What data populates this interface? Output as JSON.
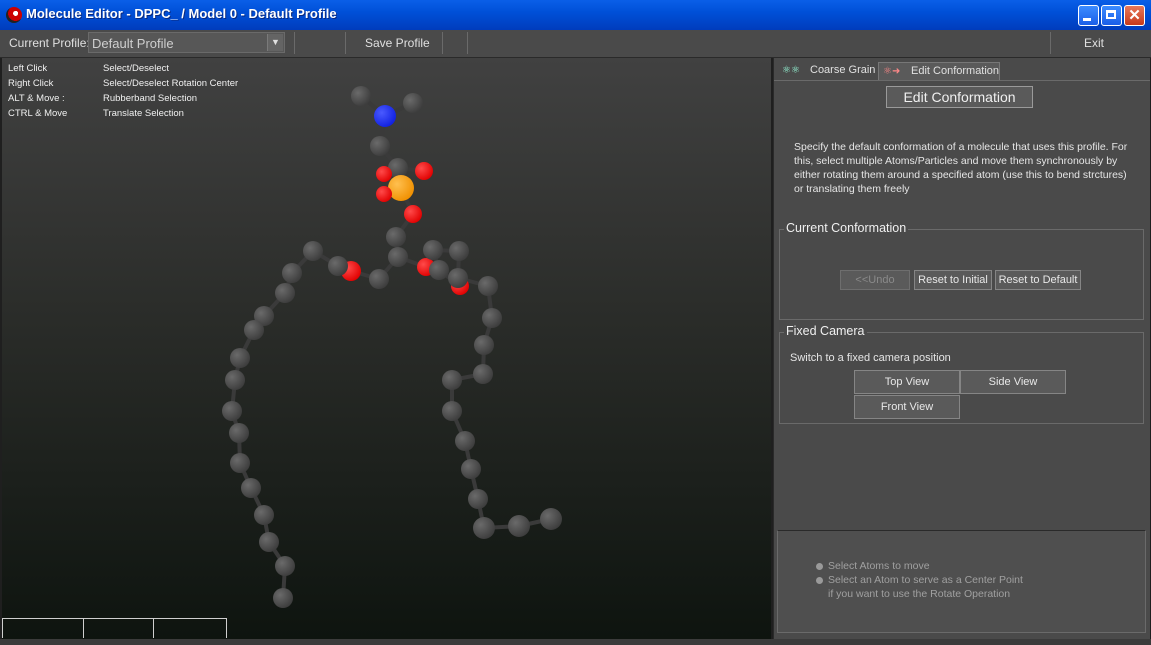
{
  "window": {
    "title": "Molecule Editor - DPPC_ / Model 0 - Default Profile"
  },
  "toolbar": {
    "profile_label": "Current Profile:",
    "profile_value": "Default Profile",
    "save_label": "Save Profile",
    "exit_label": "Exit"
  },
  "help": [
    {
      "key": "Left Click",
      "action": "Select/Deselect"
    },
    {
      "key": "Right Click",
      "action": "Select/Deselect Rotation Center"
    },
    {
      "key": "ALT & Move  :",
      "action": "Rubberband Selection"
    },
    {
      "key": "CTRL & Move",
      "action": "Translate Selection"
    }
  ],
  "tabs": [
    {
      "label": "Coarse Grain",
      "icon": "coarse-grain-icon"
    },
    {
      "label": "Edit Conformation",
      "icon": "edit-conformation-icon"
    }
  ],
  "panel": {
    "section_title": "Edit Conformation",
    "description": "Specify the default conformation of a molecule that uses this profile. For this, select multiple Atoms/Particles and move them synchronously by either rotating them around a specified atom (use this to bend strctures) or translating them freely",
    "current_conformation": {
      "title": "Current Conformation",
      "undo_label": "<<Undo",
      "reset_initial_label": "Reset to Initial",
      "reset_default_label": "Reset to Default"
    },
    "fixed_camera": {
      "title": "Fixed Camera",
      "text": "Switch to a fixed camera position",
      "top_view": "Top View",
      "side_view": "Side View",
      "front_view": "Front View"
    },
    "hints": [
      "Select Atoms to move",
      "Select an Atom to serve as a Center Point",
      "if you want to use the Rotate Operation"
    ]
  },
  "colors": {
    "atom_default": "#4a4a4a",
    "atom_oxygen": "#ff1a1a",
    "atom_nitrogen": "#1a2aff",
    "atom_phosphorus": "#ffa020",
    "titlebar": "#0054e3"
  }
}
